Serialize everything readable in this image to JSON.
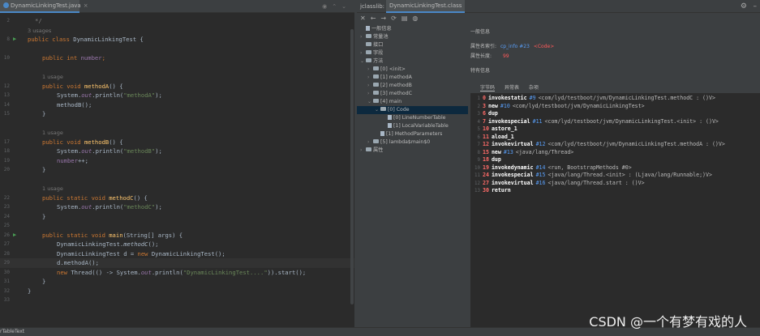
{
  "editor": {
    "tab_label": "DynamicLinkingTest.java",
    "tab_close": "×",
    "lines": [
      {
        "n": "2",
        "segs": [
          {
            "t": "*/",
            "c": "c"
          }
        ],
        "indent": 1
      },
      {
        "n": "",
        "segs": [
          {
            "t": "3 usages",
            "c": "hint"
          }
        ],
        "indent": 0
      },
      {
        "n": "8",
        "run": true,
        "segs": [
          {
            "t": "public class ",
            "c": "k"
          },
          {
            "t": "DynamicLinkingTest {",
            "c": ""
          }
        ],
        "indent": 0
      },
      {
        "n": "",
        "segs": [],
        "indent": 0
      },
      {
        "n": "10",
        "segs": [
          {
            "t": "public int ",
            "c": "k"
          },
          {
            "t": "number",
            "c": "f"
          },
          {
            "t": ";",
            "c": "k"
          }
        ],
        "indent": 2
      },
      {
        "n": "",
        "segs": [],
        "indent": 0
      },
      {
        "n": "",
        "segs": [
          {
            "t": "1 usage",
            "c": "hint"
          }
        ],
        "indent": 2
      },
      {
        "n": "12",
        "segs": [
          {
            "t": "public void ",
            "c": "k"
          },
          {
            "t": "methodA",
            "c": "m"
          },
          {
            "t": "() {",
            "c": ""
          }
        ],
        "indent": 2
      },
      {
        "n": "13",
        "segs": [
          {
            "t": "System.",
            "c": ""
          },
          {
            "t": "out",
            "c": "fi"
          },
          {
            "t": ".println(",
            "c": ""
          },
          {
            "t": "\"methodA\"",
            "c": "s"
          },
          {
            "t": ");",
            "c": ""
          }
        ],
        "indent": 4
      },
      {
        "n": "14",
        "segs": [
          {
            "t": "methodB();",
            "c": ""
          }
        ],
        "indent": 4
      },
      {
        "n": "15",
        "segs": [
          {
            "t": "}",
            "c": ""
          }
        ],
        "indent": 2
      },
      {
        "n": "",
        "segs": [],
        "indent": 0
      },
      {
        "n": "",
        "segs": [
          {
            "t": "1 usage",
            "c": "hint"
          }
        ],
        "indent": 2
      },
      {
        "n": "17",
        "segs": [
          {
            "t": "public void ",
            "c": "k"
          },
          {
            "t": "methodB",
            "c": "m"
          },
          {
            "t": "() {",
            "c": ""
          }
        ],
        "indent": 2
      },
      {
        "n": "18",
        "segs": [
          {
            "t": "System.",
            "c": ""
          },
          {
            "t": "out",
            "c": "fi"
          },
          {
            "t": ".println(",
            "c": ""
          },
          {
            "t": "\"methodB\"",
            "c": "s"
          },
          {
            "t": ");",
            "c": ""
          }
        ],
        "indent": 4
      },
      {
        "n": "19",
        "segs": [
          {
            "t": "number",
            "c": "f"
          },
          {
            "t": "++;",
            "c": ""
          }
        ],
        "indent": 4
      },
      {
        "n": "20",
        "segs": [
          {
            "t": "}",
            "c": ""
          }
        ],
        "indent": 2
      },
      {
        "n": "",
        "segs": [],
        "indent": 0
      },
      {
        "n": "",
        "segs": [
          {
            "t": "1 usage",
            "c": "hint"
          }
        ],
        "indent": 2
      },
      {
        "n": "22",
        "segs": [
          {
            "t": "public static void ",
            "c": "k"
          },
          {
            "t": "methodC",
            "c": "m"
          },
          {
            "t": "() {",
            "c": ""
          }
        ],
        "indent": 2
      },
      {
        "n": "23",
        "segs": [
          {
            "t": "System.",
            "c": ""
          },
          {
            "t": "out",
            "c": "fi"
          },
          {
            "t": ".println(",
            "c": ""
          },
          {
            "t": "\"methodC\"",
            "c": "s"
          },
          {
            "t": ");",
            "c": ""
          }
        ],
        "indent": 4
      },
      {
        "n": "24",
        "segs": [
          {
            "t": "}",
            "c": ""
          }
        ],
        "indent": 2
      },
      {
        "n": "25",
        "segs": [],
        "indent": 0
      },
      {
        "n": "26",
        "run": true,
        "segs": [
          {
            "t": "public static void ",
            "c": "k"
          },
          {
            "t": "main",
            "c": "m"
          },
          {
            "t": "(String[] args) {",
            "c": ""
          }
        ],
        "indent": 2
      },
      {
        "n": "27",
        "segs": [
          {
            "t": "DynamicLinkingTest.",
            "c": ""
          },
          {
            "t": "methodC",
            "c": "it"
          },
          {
            "t": "();",
            "c": ""
          }
        ],
        "indent": 4
      },
      {
        "n": "28",
        "segs": [
          {
            "t": "DynamicLinkingTest d = ",
            "c": ""
          },
          {
            "t": "new ",
            "c": "k"
          },
          {
            "t": "DynamicLinkingTest();",
            "c": ""
          }
        ],
        "indent": 4
      },
      {
        "n": "29",
        "current": true,
        "segs": [
          {
            "t": "d.methodA();",
            "c": ""
          }
        ],
        "indent": 4
      },
      {
        "n": "30",
        "segs": [
          {
            "t": "new ",
            "c": "k"
          },
          {
            "t": "Thread(() -> System.",
            "c": ""
          },
          {
            "t": "out",
            "c": "fi"
          },
          {
            "t": ".println(",
            "c": ""
          },
          {
            "t": "\"DynamicLinkingTest....\"",
            "c": "s"
          },
          {
            "t": ")).start();",
            "c": ""
          }
        ],
        "indent": 4
      },
      {
        "n": "31",
        "segs": [
          {
            "t": "}",
            "c": ""
          }
        ],
        "indent": 2
      },
      {
        "n": "32",
        "segs": [
          {
            "t": "}",
            "c": ""
          }
        ],
        "indent": 0
      },
      {
        "n": "33",
        "segs": [],
        "indent": 0
      }
    ]
  },
  "jclasslib": {
    "title": "jclasslib:",
    "file_tab": "DynamicLinkingTest.class",
    "tree": [
      {
        "label": "一般信息",
        "depth": 0,
        "kind": "doc",
        "arrow": ""
      },
      {
        "label": "常量池",
        "depth": 0,
        "kind": "folder",
        "arrow": "›"
      },
      {
        "label": "接口",
        "depth": 0,
        "kind": "folder",
        "arrow": ""
      },
      {
        "label": "字段",
        "depth": 0,
        "kind": "folder",
        "arrow": "›"
      },
      {
        "label": "方法",
        "depth": 0,
        "kind": "folder",
        "arrow": "⌄"
      },
      {
        "label": "[0] <init>",
        "depth": 1,
        "kind": "folder",
        "arrow": "›"
      },
      {
        "label": "[1] methodA",
        "depth": 1,
        "kind": "folder",
        "arrow": "›"
      },
      {
        "label": "[2] methodB",
        "depth": 1,
        "kind": "folder",
        "arrow": "›"
      },
      {
        "label": "[3] methodC",
        "depth": 1,
        "kind": "folder",
        "arrow": "›"
      },
      {
        "label": "[4] main",
        "depth": 1,
        "kind": "folder",
        "arrow": "⌄"
      },
      {
        "label": "[0] Code",
        "depth": 2,
        "kind": "folder",
        "arrow": "⌄",
        "selected": true
      },
      {
        "label": "[0] LineNumberTable",
        "depth": 3,
        "kind": "doc",
        "arrow": ""
      },
      {
        "label": "[1] LocalVariableTable",
        "depth": 3,
        "kind": "doc",
        "arrow": ""
      },
      {
        "label": "[1] MethodParameters",
        "depth": 2,
        "kind": "doc",
        "arrow": ""
      },
      {
        "label": "[5] lambda$main$0",
        "depth": 1,
        "kind": "folder",
        "arrow": "›"
      },
      {
        "label": "属性",
        "depth": 0,
        "kind": "folder",
        "arrow": "›"
      }
    ],
    "info": {
      "general_title": "一般信息",
      "name_index_label": "属性名索引:",
      "name_index_link": "cp_info #23",
      "name_index_value": "<Code>",
      "length_label": "属性长度:",
      "length_value": "99",
      "specific_title": "特有信息",
      "subtabs": [
        "字节码",
        "异常表",
        "杂项"
      ]
    },
    "bytecode": [
      {
        "ln": "1",
        "off": "0",
        "op": "invokestatic",
        "ref": "#9",
        "arg": "<com/lyd/testboot/jvm/DynamicLinkingTest.methodC : ()V>"
      },
      {
        "ln": "2",
        "off": "3",
        "op": "new",
        "ref": "#10",
        "arg": "<com/lyd/testboot/jvm/DynamicLinkingTest>"
      },
      {
        "ln": "3",
        "off": "6",
        "op": "dup",
        "ref": "",
        "arg": ""
      },
      {
        "ln": "4",
        "off": "7",
        "op": "invokespecial",
        "ref": "#11",
        "arg": "<com/lyd/testboot/jvm/DynamicLinkingTest.<init> : ()V>"
      },
      {
        "ln": "5",
        "off": "10",
        "op": "astore_1",
        "ref": "",
        "arg": ""
      },
      {
        "ln": "6",
        "off": "11",
        "op": "aload_1",
        "ref": "",
        "arg": ""
      },
      {
        "ln": "7",
        "off": "12",
        "op": "invokevirtual",
        "ref": "#12",
        "arg": "<com/lyd/testboot/jvm/DynamicLinkingTest.methodA : ()V>"
      },
      {
        "ln": "8",
        "off": "15",
        "op": "new",
        "ref": "#13",
        "arg": "<java/lang/Thread>"
      },
      {
        "ln": "9",
        "off": "18",
        "op": "dup",
        "ref": "",
        "arg": ""
      },
      {
        "ln": "10",
        "off": "19",
        "op": "invokedynamic",
        "ref": "#14",
        "arg": "<run, BootstrapMethods #0>"
      },
      {
        "ln": "11",
        "off": "24",
        "op": "invokespecial",
        "ref": "#15",
        "arg": "<java/lang/Thread.<init> : (Ljava/lang/Runnable;)V>"
      },
      {
        "ln": "12",
        "off": "27",
        "op": "invokevirtual",
        "ref": "#16",
        "arg": "<java/lang/Thread.start : ()V>"
      },
      {
        "ln": "13",
        "off": "30",
        "op": "return",
        "ref": "",
        "arg": ""
      }
    ]
  },
  "status": {
    "left_text": "rTableText"
  },
  "watermark": "CSDN @一个有梦有戏的人"
}
